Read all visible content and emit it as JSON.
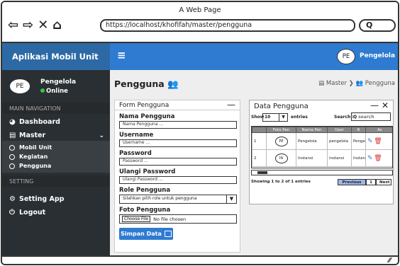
{
  "browser": {
    "window_title": "A Web Page",
    "url": "https://localhost/khofifah/master/pengguna",
    "search_glyph": "Q"
  },
  "sidebar": {
    "brand": "Aplikasi Mobil Unit",
    "avatar_initials": "PE",
    "user_name": "Pengelola",
    "status": "Online",
    "section_main": "MAIN NAVIGATION",
    "dashboard": "Dashboard",
    "master": "Master",
    "sub_items": [
      "Mobil Unit",
      "Kegiatan",
      "Pengguna"
    ],
    "section_setting": "SETTING",
    "setting_app": "Setting App",
    "logout": "Logout"
  },
  "topbar": {
    "avatar_initials": "PE",
    "user_name": "Pengelola"
  },
  "page": {
    "title": "Pengguna",
    "breadcrumb_master": "Master",
    "breadcrumb_current": "Pengguna"
  },
  "form": {
    "header": "Form Pengguna",
    "nama_label": "Nama Pengguna",
    "nama_placeholder": "Nama Pengguna ...",
    "username_label": "Username",
    "username_placeholder": "Username ...",
    "password_label": "Password",
    "password_placeholder": "Password ...",
    "ulangi_label": "Ulangi Password",
    "ulangi_placeholder": "Ulangi Password ...",
    "role_label": "Role Pengguna",
    "role_placeholder": "Silahkan pilih role untuk pengguna",
    "foto_label": "Foto Pengguna",
    "choose_file": "Choose File",
    "no_file": "No file chosen",
    "submit": "Simpan Data"
  },
  "table": {
    "header": "Data Pengguna",
    "show_label": "Show",
    "show_value": "10",
    "entries_label": "entries",
    "search_label": "Search :",
    "search_placeholder": "search",
    "columns": [
      "",
      "Foto Pen",
      "Nama Pen",
      "User",
      "R",
      "Ac"
    ],
    "rows": [
      {
        "no": "1",
        "foto": "PE",
        "nama": "Pengelola",
        "user": "pengelola",
        "role": "Penge"
      },
      {
        "no": "2",
        "foto": "IN",
        "nama": "Instansi",
        "user": "instansi",
        "role": "Instan"
      }
    ],
    "info": "Showing 1 to 2 of 1 entries",
    "prev": "Previous",
    "page": "1",
    "next": "Next"
  }
}
